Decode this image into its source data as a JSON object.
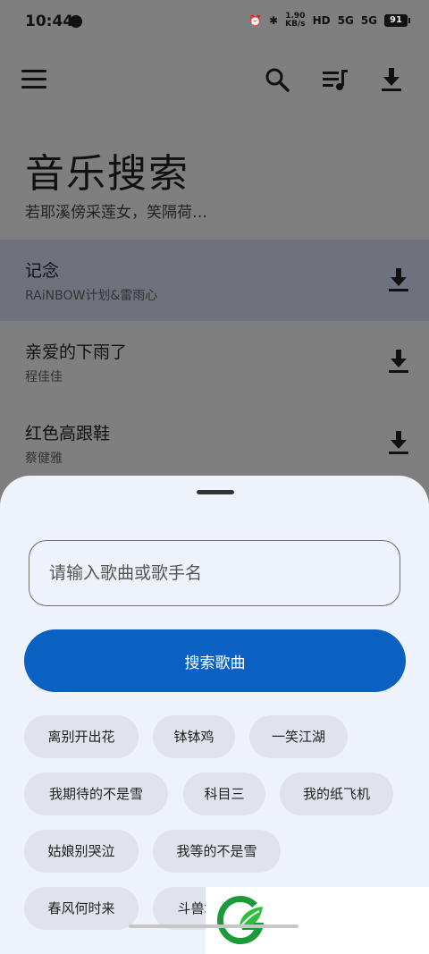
{
  "status_bar": {
    "time": "10:44",
    "speed_value": "1.90",
    "speed_unit": "KB/s",
    "net1": "5G",
    "net2": "5G",
    "battery": "91"
  },
  "app": {
    "page_title": "音乐搜索",
    "page_subtitle": "若耶溪傍采莲女，笑隔荷…"
  },
  "songs": [
    {
      "title": "记念",
      "artist": "RAiNBOW计划&雷雨心"
    },
    {
      "title": "亲爱的下雨了",
      "artist": "程佳佳"
    },
    {
      "title": "红色高跟鞋",
      "artist": "蔡健雅"
    }
  ],
  "sheet": {
    "search_placeholder": "请输入歌曲或歌手名",
    "search_button_label": "搜索歌曲",
    "chips": [
      "离别开出花",
      "钵钵鸡",
      "一笑江湖",
      "我期待的不是雪",
      "科目三",
      "我的纸飞机",
      "姑娘别哭泣",
      "我等的不是雪",
      "春风何时来",
      "斗兽场"
    ]
  },
  "colors": {
    "accent": "#0a61c2",
    "sheet_bg": "#eef2fb",
    "chip_bg": "#e0e3ec"
  }
}
